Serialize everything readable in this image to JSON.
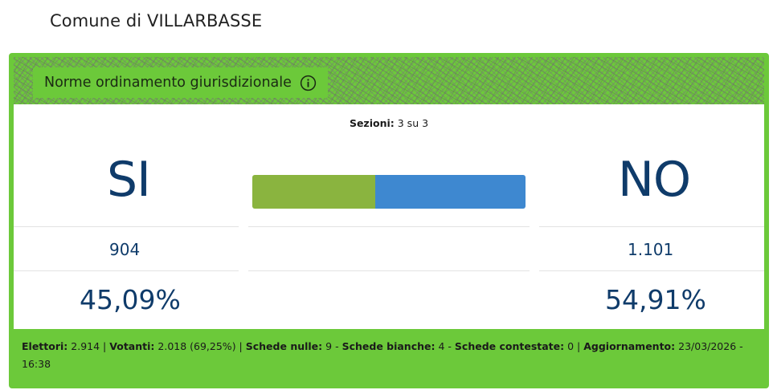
{
  "page": {
    "comune_title": "Comune di VILLARBASSE"
  },
  "card": {
    "header_title": "Norme ordinamento giurisdizionale",
    "info_icon": "info-circle-icon",
    "sezioni_label": "Sezioni:",
    "sezioni_value": "3 su 3",
    "si": {
      "label": "SI",
      "votes": "904",
      "percent": "45,09%",
      "percent_value": 45.09,
      "color": "#8ab43f"
    },
    "no": {
      "label": "NO",
      "votes": "1.101",
      "percent": "54,91%",
      "percent_value": 54.91,
      "color": "#3e88d0"
    },
    "footer": {
      "elettori_label": "Elettori:",
      "elettori_value": "2.914",
      "sep1": " | ",
      "votanti_label": "Votanti:",
      "votanti_value": "2.018 (69,25%)",
      "sep2": " | ",
      "nulle_label": "Schede nulle:",
      "nulle_value": "9",
      "dash1": " - ",
      "bianche_label": "Schede bianche:",
      "bianche_value": "4",
      "dash2": " - ",
      "contestate_label": "Schede contestate:",
      "contestate_value": "0",
      "sep3": " | ",
      "aggiornamento_label": "Aggiornamento:",
      "aggiornamento_value": "23/03/2026 - 16:38"
    }
  },
  "colors": {
    "accent_green": "#6cc93a",
    "number_blue": "#0f3b6a"
  }
}
